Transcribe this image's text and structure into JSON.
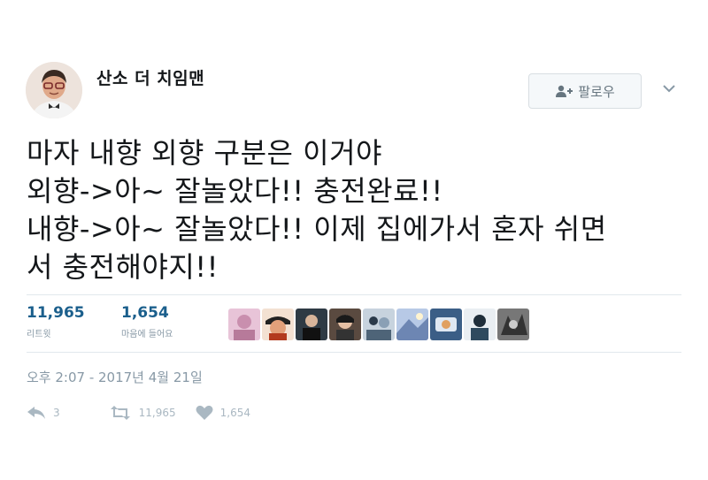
{
  "profile": {
    "display_name": "산소 더 치임맨",
    "avatar_icon": "profile-photo"
  },
  "follow": {
    "label": "팔로우",
    "icon": "add-user-icon"
  },
  "menu": {
    "icon": "chevron-down-icon"
  },
  "tweet": {
    "text": "마자 내향 외향 구분은 이거야\n외향->아~ 잘놀았다!! 충전완료!!\n내향->아~ 잘놀았다!! 이제 집에가서 혼자 쉬면\n서 충전해야지!!"
  },
  "stats": {
    "retweets": {
      "value": "11,965",
      "label": "리트윗"
    },
    "likes": {
      "value": "1,654",
      "label": "마음에 들어요"
    }
  },
  "likers": [
    "liker-1",
    "liker-2",
    "liker-3",
    "liker-4",
    "liker-5",
    "liker-6",
    "liker-7",
    "liker-8",
    "liker-9"
  ],
  "timestamp": "오후 2:07 - 2017년 4월 21일",
  "actions": {
    "reply": {
      "icon": "reply-icon",
      "count": "3"
    },
    "retweet": {
      "icon": "retweet-icon",
      "count": "11,965"
    },
    "like": {
      "icon": "heart-icon",
      "count": "1,654"
    }
  },
  "colors": {
    "stat_number": "#1b5f8c",
    "muted_text": "#8899a6",
    "divider": "#e1e8ed",
    "action_icon": "#aab8c2"
  }
}
